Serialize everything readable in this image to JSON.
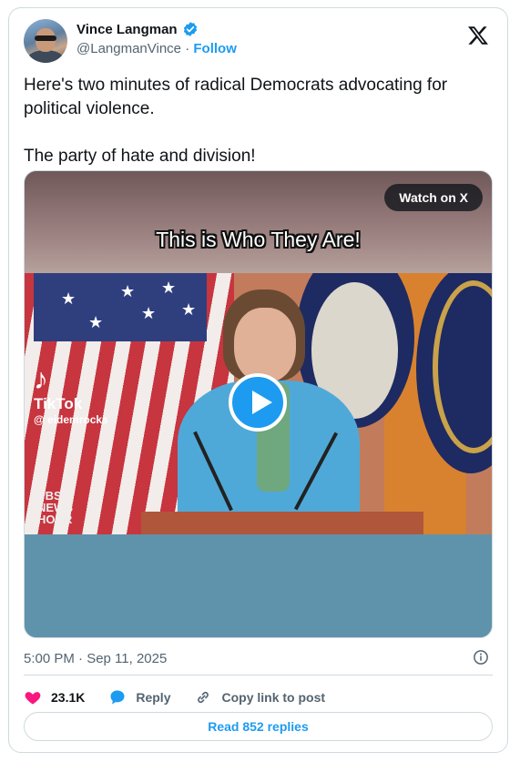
{
  "author": {
    "name": "Vince Langman",
    "handle": "@LangmanVince",
    "separator": "·",
    "follow_label": "Follow",
    "verified_color": "#1d9bf0"
  },
  "platform_icon": "x-logo-icon",
  "tweet": {
    "line1": "Here's two minutes of radical Democrats advocating for political violence.",
    "line2": "The party of hate and division!"
  },
  "media": {
    "caption": "This is Who They Are!",
    "watch_label": "Watch on X",
    "tiktok_word": "TikTok",
    "tiktok_handle": "@ eidemrocks",
    "pbs_line1": "PBS",
    "pbs_line2": "NEWS",
    "pbs_line3": "HOUR",
    "play_icon": "play-icon"
  },
  "timestamp": "5:00 PM · Sep 11, 2025",
  "actions": {
    "likes": "23.1K",
    "reply_label": "Reply",
    "copy_label": "Copy link to post"
  },
  "read_replies_label": "Read 852 replies",
  "colors": {
    "accent": "#1d9bf0",
    "like": "#f91880",
    "muted": "#536471",
    "border": "#cfd9de"
  }
}
